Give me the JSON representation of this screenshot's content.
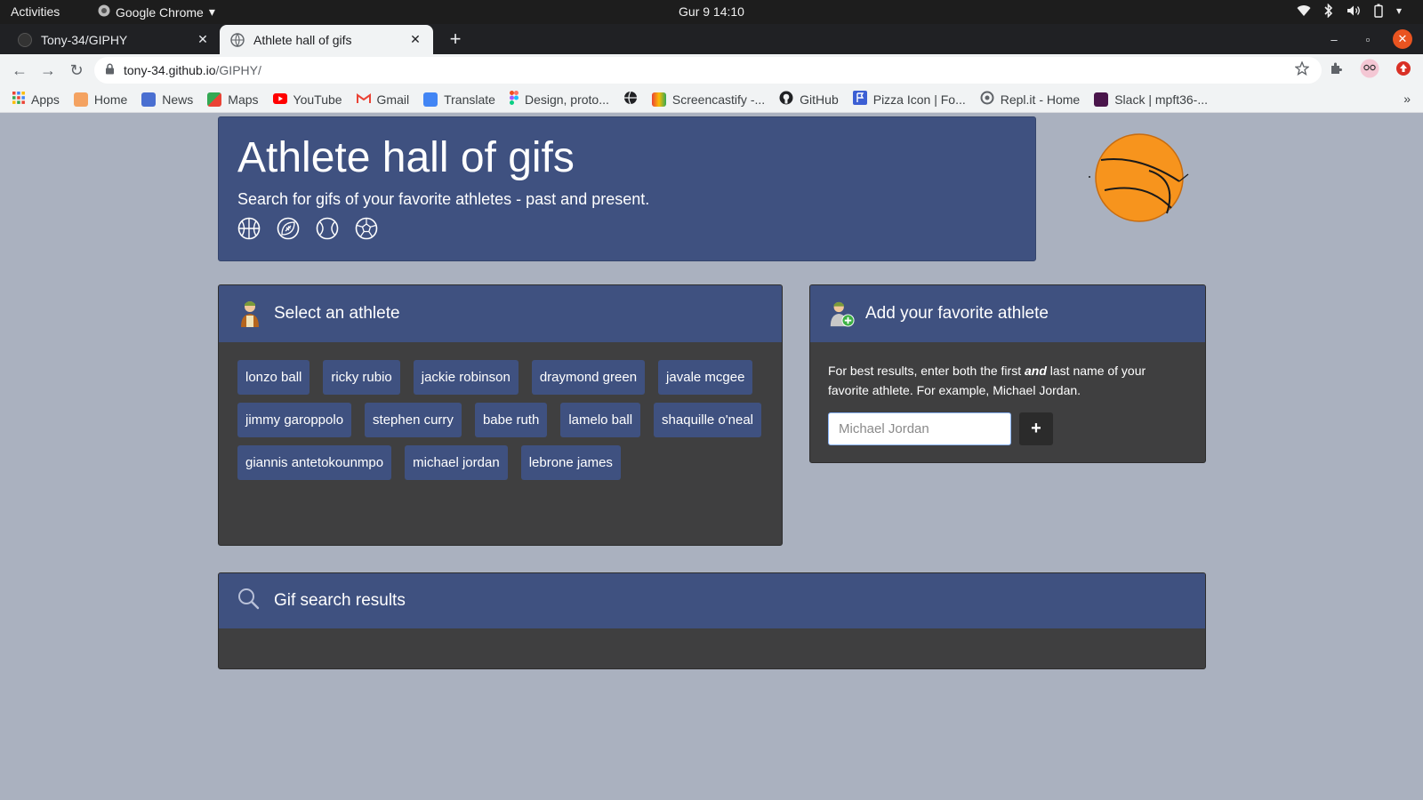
{
  "os_bar": {
    "activities": "Activities",
    "app_name": "Google Chrome",
    "clock": "Gur 9  14:10"
  },
  "browser": {
    "tabs": [
      {
        "title": "Tony-34/GIPHY",
        "active": false
      },
      {
        "title": "Athlete hall of gifs",
        "active": true
      }
    ],
    "url_host": "tony-34.github.io",
    "url_path": "/GIPHY/",
    "bookmarks": [
      {
        "label": "Apps",
        "icon": "apps-grid-icon"
      },
      {
        "label": "Home",
        "icon": "home-icon"
      },
      {
        "label": "News",
        "icon": "news-icon"
      },
      {
        "label": "Maps",
        "icon": "maps-icon"
      },
      {
        "label": "YouTube",
        "icon": "youtube-icon"
      },
      {
        "label": "Gmail",
        "icon": "gmail-icon"
      },
      {
        "label": "Translate",
        "icon": "translate-icon"
      },
      {
        "label": "Design, proto...",
        "icon": "figma-icon"
      },
      {
        "label": "",
        "icon": "globe-icon"
      },
      {
        "label": "Screencastify -...",
        "icon": "screencastify-icon"
      },
      {
        "label": "GitHub",
        "icon": "github-icon"
      },
      {
        "label": "Pizza Icon | Fo...",
        "icon": "flag-icon"
      },
      {
        "label": "Repl.it - Home",
        "icon": "replit-icon"
      },
      {
        "label": "Slack | mpft36-...",
        "icon": "slack-icon"
      }
    ]
  },
  "page": {
    "title": "Athlete hall of gifs",
    "subtitle": "Search for gifs of your favorite athletes - past and present.",
    "athletes_card": {
      "heading": "Select an athlete",
      "athletes": [
        "lonzo ball",
        "ricky rubio",
        "jackie robinson",
        "draymond green",
        "javale mcgee",
        "jimmy garoppolo",
        "stephen curry",
        "babe ruth",
        "lamelo ball",
        "shaquille o'neal",
        "giannis antetokounmpo",
        "michael jordan",
        "lebrone james"
      ]
    },
    "add_card": {
      "heading": "Add your favorite athlete",
      "instructions_before": "For best results, enter both the first ",
      "instructions_emphasis": "and",
      "instructions_after": " last name of your favorite athlete. For example, Michael Jordan.",
      "input_value": "",
      "input_placeholder": "Michael Jordan",
      "add_button_label": "+"
    },
    "results_card": {
      "heading": "Gif search results"
    }
  },
  "colors": {
    "page_background": "#aab1bf",
    "header_blue": "#3f5180",
    "card_body": "#3f3f40",
    "ball_orange": "#f7941d"
  }
}
